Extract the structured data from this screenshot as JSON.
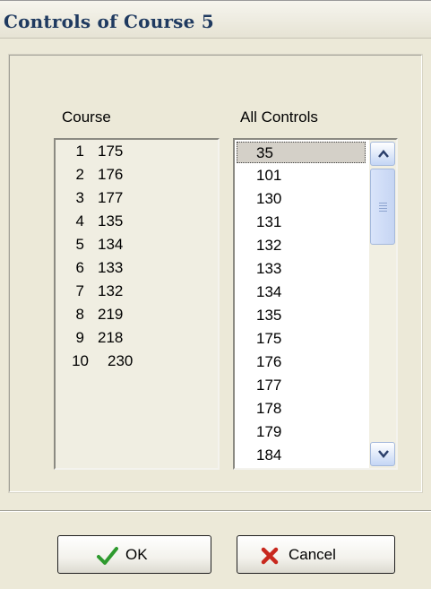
{
  "window": {
    "title": "Controls of Course 5"
  },
  "course": {
    "label": "Course",
    "items": [
      {
        "num": "1",
        "code": "175"
      },
      {
        "num": "2",
        "code": "176"
      },
      {
        "num": "3",
        "code": "177"
      },
      {
        "num": "4",
        "code": "135"
      },
      {
        "num": "5",
        "code": "134"
      },
      {
        "num": "6",
        "code": "133"
      },
      {
        "num": "7",
        "code": "132"
      },
      {
        "num": "8",
        "code": "219"
      },
      {
        "num": "9",
        "code": "218"
      },
      {
        "num": "10",
        "code": "230"
      }
    ]
  },
  "all_controls": {
    "label": "All Controls",
    "selected": "35",
    "items": [
      "35",
      "101",
      "130",
      "131",
      "132",
      "133",
      "134",
      "135",
      "175",
      "176",
      "177",
      "178",
      "179",
      "184"
    ]
  },
  "buttons": {
    "ok_label": "OK",
    "cancel_label": "Cancel"
  },
  "icons": {
    "ok": "check-icon",
    "cancel": "x-icon",
    "scroll_up": "chevron-up-icon",
    "scroll_down": "chevron-down-icon"
  },
  "colors": {
    "title_text": "#1f3a60",
    "ok_check": "#2e9a2e",
    "cancel_x": "#c8281e",
    "dialog_bg": "#ece9d8"
  }
}
